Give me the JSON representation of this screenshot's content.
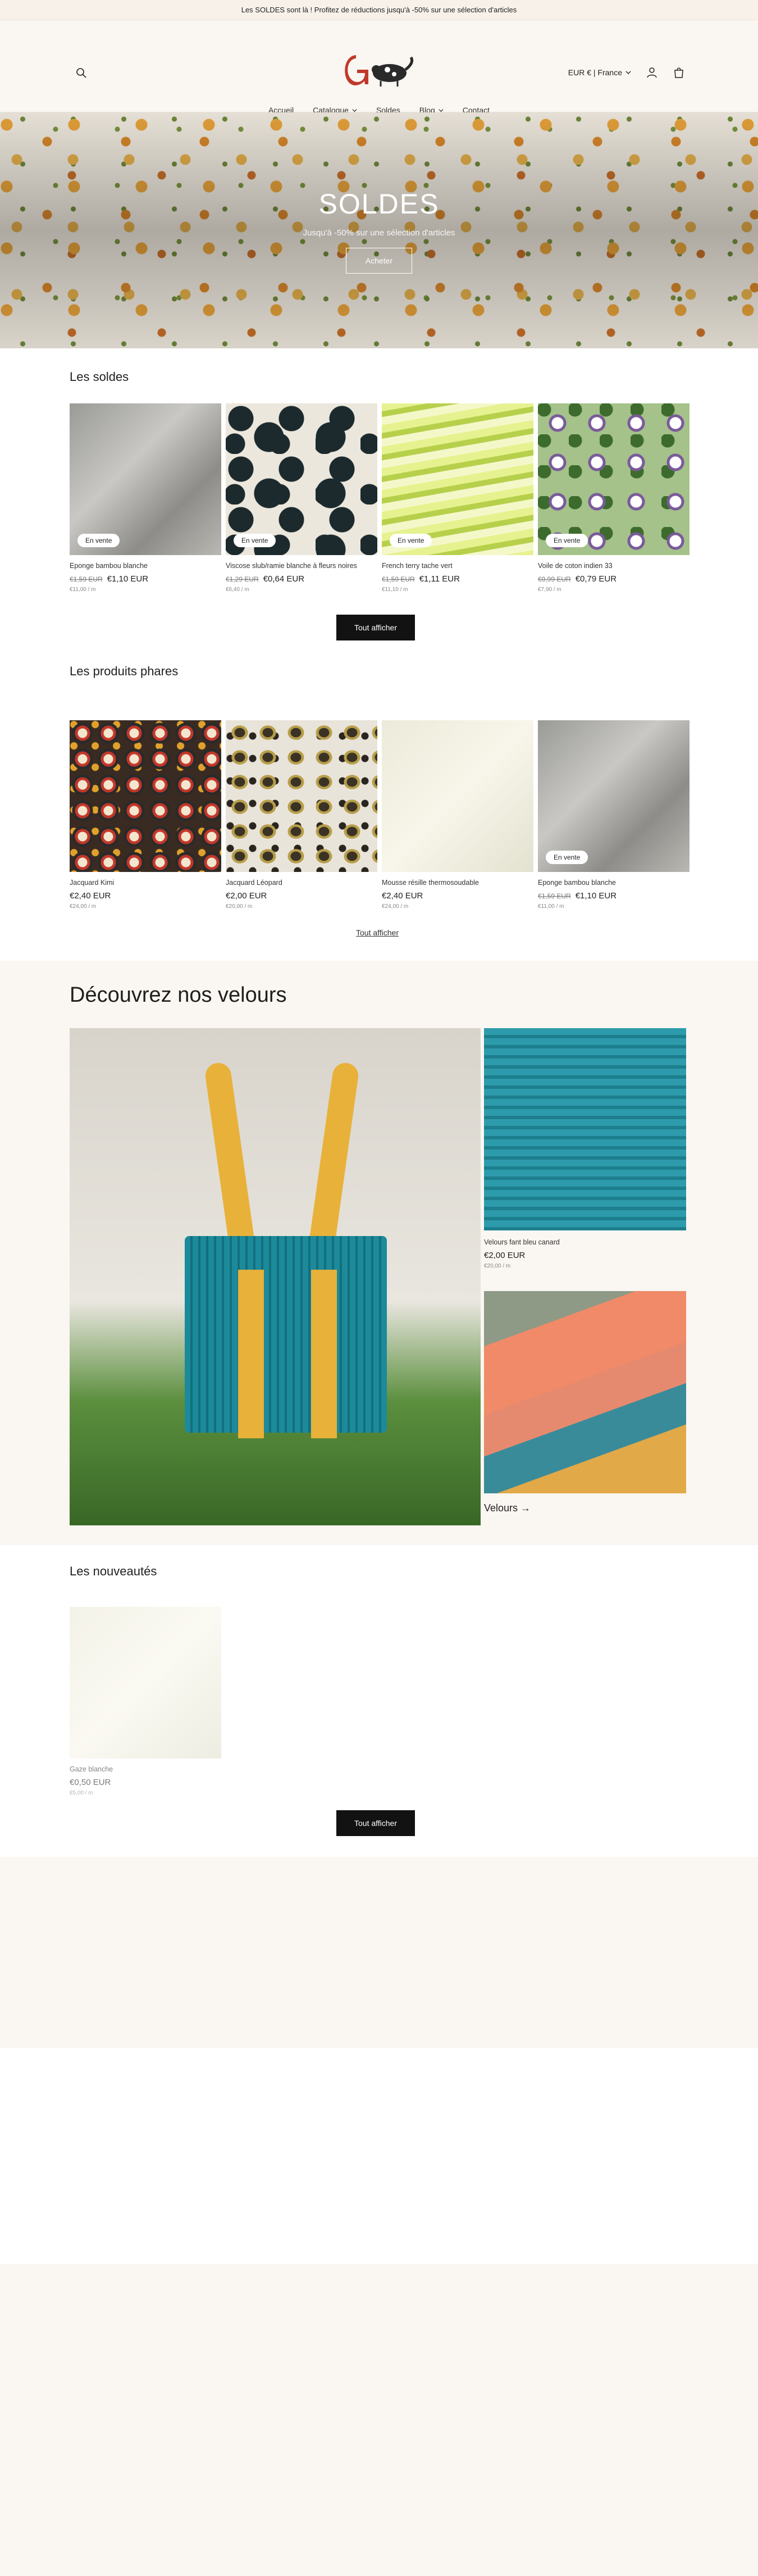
{
  "announcement": "Les SOLDES sont là ! Profitez de réductions jusqu'à -50% sur une sélection d'articles",
  "header": {
    "country": "EUR € | France",
    "nav": [
      "Accueil",
      "Catalogue",
      "Soldes",
      "Blog",
      "Contact"
    ]
  },
  "hero": {
    "title": "SOLDES",
    "subtitle": "Jusqu'à -50% sur une sélection d'articles",
    "button": "Acheter"
  },
  "sales": {
    "title": "Les soldes",
    "button": "Tout afficher",
    "products": [
      {
        "name": "Eponge bambou blanche",
        "old": "€1,59 EUR",
        "price": "€1,10 EUR",
        "unit": "€11,00 / m",
        "badge": "En vente"
      },
      {
        "name": "Viscose slub/ramie blanche à fleurs noires",
        "old": "€1,29 EUR",
        "price": "€0,64 EUR",
        "unit": "€6,40 / m",
        "badge": "En vente"
      },
      {
        "name": "French terry tache vert",
        "old": "€1,59 EUR",
        "price": "€1,11 EUR",
        "unit": "€11,10 / m",
        "badge": "En vente"
      },
      {
        "name": "Voile de coton indien 33",
        "old": "€0,99 EUR",
        "price": "€0,79 EUR",
        "unit": "€7,90 / m",
        "badge": "En vente"
      }
    ]
  },
  "featured": {
    "title": "Les produits phares",
    "link": "Tout afficher",
    "products": [
      {
        "name": "Jacquard Kimi",
        "old": "",
        "price": "€2,40 EUR",
        "unit": "€24,00 / m",
        "badge": ""
      },
      {
        "name": "Jacquard Léopard",
        "old": "",
        "price": "€2,00 EUR",
        "unit": "€20,00 / m",
        "badge": ""
      },
      {
        "name": "Mousse résille thermosoudable",
        "old": "",
        "price": "€2,40 EUR",
        "unit": "€24,00 / m",
        "badge": ""
      },
      {
        "name": "Eponge bambou blanche",
        "old": "€1,59 EUR",
        "price": "€1,10 EUR",
        "unit": "€11,00 / m",
        "badge": "En vente"
      }
    ]
  },
  "velours": {
    "title": "Découvrez nos velours",
    "product_name": "Velours fant bleu canard",
    "product_price": "€2,00 EUR",
    "product_unit": "€20,00 / m",
    "collection_link": "Velours →"
  },
  "news": {
    "title": "Les nouveautés",
    "product_name": "Gaze blanche",
    "product_price": "€0,50 EUR",
    "product_unit": "€5,00 / m",
    "button": "Tout afficher"
  }
}
